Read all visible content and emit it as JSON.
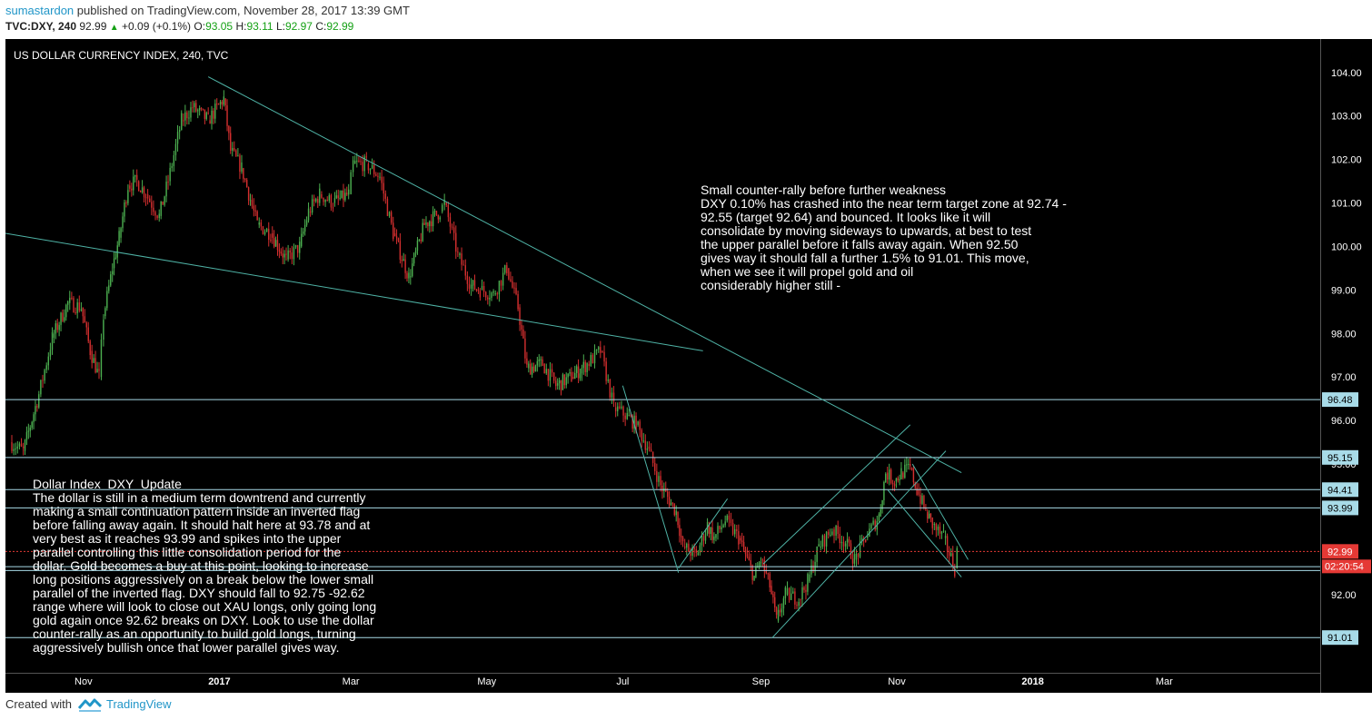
{
  "header": {
    "author": "sumastardon",
    "published_text": "published on TradingView.com, November 28, 2017 13:39 GMT",
    "symbol": "TVC:DXY, 240",
    "price": "92.99",
    "change": "+0.09 (+0.1%)",
    "o_label": "O:",
    "o_value": "93.05",
    "h_label": "H:",
    "h_value": "93.11",
    "l_label": "L:",
    "l_value": "92.97",
    "c_label": "C:",
    "c_value": "92.99"
  },
  "footer": {
    "created_with": "Created with",
    "brand": "TradingView"
  },
  "annotations": {
    "right": "Small counter-rally before further weakness\nDXY 0.10% has crashed into the near term target zone at 92.74 -\n92.55 (target 92.64) and bounced. It looks like it will\nconsolidate by moving sideways to upwards, at best to test\nthe upper parallel before it falls away again. When 92.50\ngives way it should fall a further 1.5% to 91.01. This move,\nwhen we see it will propel gold and oil\nconsiderably higher still -",
    "left": "Dollar Index  DXY  Update\nThe dollar is still in a medium term downtrend and currently\nmaking a small continuation pattern inside an inverted flag\nbefore falling away again. It should halt here at 93.78 and at\nvery best as it reaches 93.99 and spikes into the upper\nparallel controlling this little consolidation period for the\ndollar. Gold becomes a buy at this point, looking to increase\nlong positions aggressively on a break below the lower small\nparallel of the inverted flag. DXY should fall to 92.75 -92.62\nrange where will look to close out XAU longs, only going long\ngold again once 92.62 breaks on DXY. Look to use the dollar\ncounter-rally as an opportunity to build gold longs, turning\naggressively bullish once that lower parallel gives way."
  },
  "chart_data": {
    "type": "line",
    "title": "US DOLLAR CURRENCY INDEX, 240, TVC",
    "x_ticks": [
      "Nov",
      "2017",
      "Mar",
      "May",
      "Jul",
      "Sep",
      "Nov",
      "2018",
      "Mar"
    ],
    "y_ticks": [
      "104.00",
      "103.00",
      "102.00",
      "101.00",
      "100.00",
      "99.00",
      "98.00",
      "97.00",
      "96.00",
      "95.00",
      "94.00",
      "93.00",
      "92.00",
      "91.00"
    ],
    "ylim": [
      90.2,
      104.6
    ],
    "xlim": [
      "2016-09-27",
      "2018-05-10"
    ],
    "series": [
      {
        "values": [
          [
            "2016-09-29",
            95.5
          ],
          [
            "2016-10-05",
            95.3
          ],
          [
            "2016-10-12",
            96.6
          ],
          [
            "2016-10-18",
            97.9
          ],
          [
            "2016-10-25",
            98.7
          ],
          [
            "2016-10-31",
            98.6
          ],
          [
            "2016-11-04",
            97.6
          ],
          [
            "2016-11-08",
            97.0
          ],
          [
            "2016-11-10",
            98.4
          ],
          [
            "2016-11-14",
            99.5
          ],
          [
            "2016-11-17",
            100.2
          ],
          [
            "2016-11-21",
            101.4
          ],
          [
            "2016-11-25",
            101.5
          ],
          [
            "2016-11-29",
            101.2
          ],
          [
            "2016-12-05",
            100.7
          ],
          [
            "2016-12-09",
            101.5
          ],
          [
            "2016-12-15",
            102.9
          ],
          [
            "2016-12-20",
            103.2
          ],
          [
            "2016-12-27",
            102.9
          ],
          [
            "2017-01-03",
            103.4
          ],
          [
            "2017-01-06",
            102.2
          ],
          [
            "2017-01-11",
            101.8
          ],
          [
            "2017-01-18",
            100.5
          ],
          [
            "2017-01-24",
            100.3
          ],
          [
            "2017-01-31",
            99.7
          ],
          [
            "2017-02-06",
            100.0
          ],
          [
            "2017-02-10",
            100.8
          ],
          [
            "2017-02-15",
            101.2
          ],
          [
            "2017-02-21",
            101.0
          ],
          [
            "2017-02-28",
            101.2
          ],
          [
            "2017-03-02",
            101.9
          ],
          [
            "2017-03-08",
            101.9
          ],
          [
            "2017-03-14",
            101.6
          ],
          [
            "2017-03-20",
            100.3
          ],
          [
            "2017-03-27",
            99.3
          ],
          [
            "2017-04-03",
            100.5
          ],
          [
            "2017-04-10",
            100.8
          ],
          [
            "2017-04-12",
            101.0
          ],
          [
            "2017-04-18",
            99.8
          ],
          [
            "2017-04-24",
            99.1
          ],
          [
            "2017-04-28",
            99.0
          ],
          [
            "2017-05-04",
            98.9
          ],
          [
            "2017-05-10",
            99.5
          ],
          [
            "2017-05-15",
            98.6
          ],
          [
            "2017-05-19",
            97.2
          ],
          [
            "2017-05-26",
            97.3
          ],
          [
            "2017-06-01",
            96.8
          ],
          [
            "2017-06-08",
            97.0
          ],
          [
            "2017-06-15",
            97.3
          ],
          [
            "2017-06-21",
            97.6
          ],
          [
            "2017-06-27",
            96.3
          ],
          [
            "2017-07-03",
            96.1
          ],
          [
            "2017-07-07",
            95.9
          ],
          [
            "2017-07-12",
            95.4
          ],
          [
            "2017-07-18",
            94.5
          ],
          [
            "2017-07-25",
            93.9
          ],
          [
            "2017-07-28",
            93.1
          ],
          [
            "2017-08-03",
            92.9
          ],
          [
            "2017-08-08",
            93.6
          ],
          [
            "2017-08-11",
            93.3
          ],
          [
            "2017-08-16",
            93.7
          ],
          [
            "2017-08-22",
            93.3
          ],
          [
            "2017-08-29",
            92.4
          ],
          [
            "2017-09-01",
            92.8
          ],
          [
            "2017-09-05",
            92.2
          ],
          [
            "2017-09-08",
            91.4
          ],
          [
            "2017-09-12",
            92.0
          ],
          [
            "2017-09-18",
            91.9
          ],
          [
            "2017-09-22",
            92.3
          ],
          [
            "2017-09-27",
            93.1
          ],
          [
            "2017-10-03",
            93.5
          ],
          [
            "2017-10-09",
            93.2
          ],
          [
            "2017-10-13",
            92.8
          ],
          [
            "2017-10-18",
            93.3
          ],
          [
            "2017-10-24",
            93.8
          ],
          [
            "2017-10-27",
            94.8
          ],
          [
            "2017-10-31",
            94.6
          ],
          [
            "2017-11-03",
            94.8
          ],
          [
            "2017-11-07",
            94.9
          ],
          [
            "2017-11-10",
            94.4
          ],
          [
            "2017-11-14",
            93.9
          ],
          [
            "2017-11-17",
            93.6
          ],
          [
            "2017-11-22",
            93.3
          ],
          [
            "2017-11-27",
            92.6
          ],
          [
            "2017-11-28",
            92.99
          ]
        ]
      }
    ],
    "horizontal_levels": [
      {
        "value": 96.48,
        "label": "96.48"
      },
      {
        "value": 95.15,
        "label": "95.15"
      },
      {
        "value": 94.41,
        "label": "94.41"
      },
      {
        "value": 93.99,
        "label": "93.99"
      },
      {
        "value": 92.99,
        "label": "92.99",
        "style": "last-price"
      },
      {
        "value": 92.64
      },
      {
        "value": 92.55
      },
      {
        "value": 91.01,
        "label": "91.01"
      }
    ],
    "trendlines": [
      {
        "from": [
          "2016-12-27",
          103.9
        ],
        "to": [
          "2017-11-30",
          94.8
        ]
      },
      {
        "from": [
          "2016-09-27",
          100.3
        ],
        "to": [
          "2017-08-06",
          97.6
        ]
      },
      {
        "from": [
          "2017-07-01",
          96.8
        ],
        "to": [
          "2017-07-26",
          92.5
        ]
      },
      {
        "from": [
          "2017-07-26",
          92.6
        ],
        "to": [
          "2017-08-17",
          94.2
        ]
      },
      {
        "from": [
          "2017-09-06",
          91.0
        ],
        "to": [
          "2017-11-23",
          95.3
        ]
      },
      {
        "from": [
          "2017-09-02",
          92.7
        ],
        "to": [
          "2017-11-07",
          95.9
        ]
      },
      {
        "from": [
          "2017-10-28",
          94.4
        ],
        "to": [
          "2017-11-30",
          92.4
        ]
      },
      {
        "from": [
          "2017-11-08",
          95.0
        ],
        "to": [
          "2017-12-03",
          92.8
        ]
      }
    ],
    "last_price": "92.99",
    "countdown": "02:20:54",
    "colors": {
      "background": "#000000",
      "up": "#4caf50",
      "down": "#d32f2f",
      "trendline": "#4fb3a6",
      "level": "#a8dbe8",
      "last_price": "#e53935"
    }
  }
}
